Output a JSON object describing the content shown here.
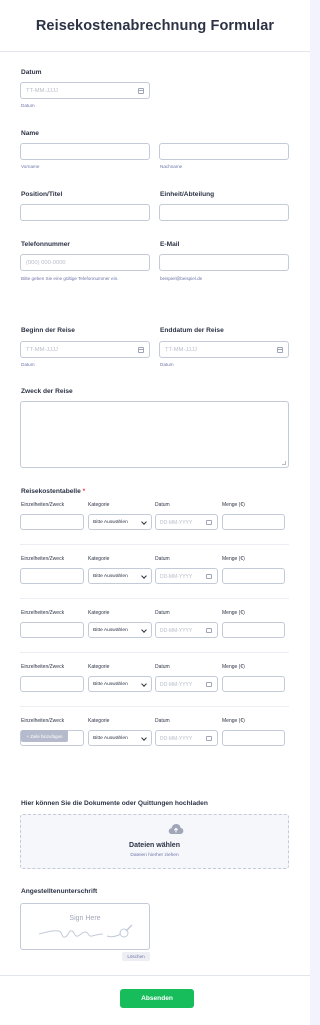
{
  "form": {
    "title": "Reisekostenabrechnung Formular",
    "submit_label": "Absenden"
  },
  "fields": {
    "date": {
      "label": "Datum",
      "placeholder": "TT-MM-JJJJ",
      "sublabel": "Datum"
    },
    "name": {
      "label": "Name",
      "first_sublabel": "Vorname",
      "last_sublabel": "Nachname"
    },
    "position": {
      "label": "Position/Titel"
    },
    "department": {
      "label": "Einheit/Abteilung"
    },
    "phone": {
      "label": "Telefonnummer",
      "placeholder": "(000) 000-0000",
      "sublabel": "Bitte geben Sie eine gültige Telefonnummer ein."
    },
    "email": {
      "label": "E-Mail",
      "sublabel": "beispiel@beispiel.de"
    },
    "trip_start": {
      "label": "Beginn der Reise",
      "placeholder": "TT-MM-JJJJ",
      "sublabel": "Datum"
    },
    "trip_end": {
      "label": "Enddatum der Reise",
      "placeholder": "TT-MM-JJJJ",
      "sublabel": "Datum"
    },
    "purpose": {
      "label": "Zweck der Reise"
    }
  },
  "expense_table": {
    "label": "Reisekostentabelle",
    "required_mark": "*",
    "columns": [
      "Einzelheiten/Zweck",
      "Kategorie",
      "Datum",
      "Menge (€)"
    ],
    "select_value": "Bitte Auswählen",
    "date_placeholder": "DD-MM-YYYY",
    "add_row_label": "+ Zeile hinzufügen"
  },
  "upload": {
    "label": "Hier können Sie die Dokumente oder Quittungen hochladen",
    "title": "Dateien wählen",
    "hint": "Dateien hierher ziehen"
  },
  "signature": {
    "label": "Angestelltenunterschrift",
    "placeholder": "Sign Here",
    "clear_label": "Löschen"
  },
  "colors": {
    "submit": "#18bd5b",
    "border": "#c3cad8",
    "required": "#f23a3c"
  }
}
